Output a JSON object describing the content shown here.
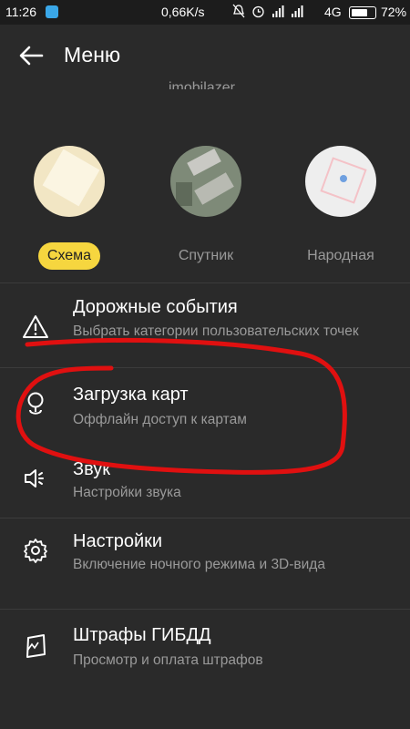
{
  "status_bar": {
    "time": "11:26",
    "speed": "0,66K/s",
    "network": "4G",
    "battery": "72%"
  },
  "app_bar": {
    "title": "Меню"
  },
  "partial_text": "imobilazer",
  "map_layers": [
    {
      "label": "Схема",
      "selected": true
    },
    {
      "label": "Спутник",
      "selected": false
    },
    {
      "label": "Народная",
      "selected": false
    }
  ],
  "menu_items": [
    {
      "icon": "warning-icon",
      "title": "Дорожные события",
      "subtitle": "Выбрать категории пользовательских точек"
    },
    {
      "icon": "map-pin-download-icon",
      "title": "Загрузка карт",
      "subtitle": "Оффлайн доступ к картам"
    },
    {
      "icon": "speaker-icon",
      "title": "Звук",
      "subtitle": "Настройки звука"
    },
    {
      "icon": "gear-icon",
      "title": "Настройки",
      "subtitle": "Включение ночного режима и 3D-вида"
    },
    {
      "icon": "fine-ticket-icon",
      "title": "Штрафы ГИБДД",
      "subtitle": "Просмотр и оплата штрафов"
    }
  ],
  "colors": {
    "background": "#2a2a2a",
    "accent": "#f6d63f",
    "annotation": "#e01010"
  }
}
